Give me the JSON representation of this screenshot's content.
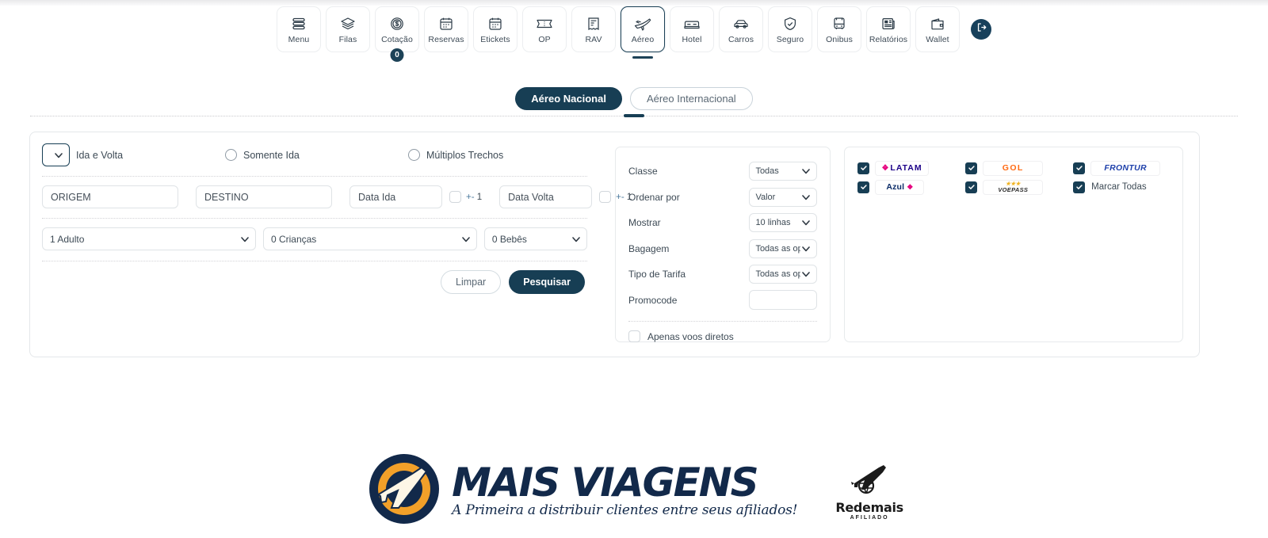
{
  "toolbar": {
    "items": [
      {
        "label": "Menu",
        "icon": "menu-stack-icon",
        "active": false
      },
      {
        "label": "Filas",
        "icon": "layers-icon",
        "active": false
      },
      {
        "label": "Cotação",
        "icon": "coin-dollar-icon",
        "active": false,
        "badge": "0"
      },
      {
        "label": "Reservas",
        "icon": "calendar-icon",
        "active": false
      },
      {
        "label": "Etickets",
        "icon": "calendar-icon",
        "active": false
      },
      {
        "label": "OP",
        "icon": "ticket-icon",
        "active": false
      },
      {
        "label": "RAV",
        "icon": "receipt-icon",
        "active": false
      },
      {
        "label": "Aéreo",
        "icon": "airplane-icon",
        "active": true
      },
      {
        "label": "Hotel",
        "icon": "bed-icon",
        "active": false
      },
      {
        "label": "Carros",
        "icon": "car-icon",
        "active": false
      },
      {
        "label": "Seguro",
        "icon": "shield-icon",
        "active": false
      },
      {
        "label": "Onibus",
        "icon": "bus-icon",
        "active": false
      },
      {
        "label": "Relatórios",
        "icon": "report-icon",
        "active": false
      },
      {
        "label": "Wallet",
        "icon": "wallet-icon",
        "active": false
      }
    ],
    "logout_icon": "logout-icon"
  },
  "tabs": [
    {
      "label": "Aéreo Nacional",
      "selected": true
    },
    {
      "label": "Aéreo Internacional",
      "selected": false
    }
  ],
  "search": {
    "trip_types": [
      {
        "label": "Ida e Volta",
        "selected": true
      },
      {
        "label": "Somente Ida",
        "selected": false
      },
      {
        "label": "Múltiplos Trechos",
        "selected": false
      }
    ],
    "origem": {
      "value": "",
      "placeholder": "ORIGEM"
    },
    "destino": {
      "value": "",
      "placeholder": "DESTINO"
    },
    "data_ida": {
      "value": "",
      "placeholder": "Data Ida"
    },
    "data_volta": {
      "value": "",
      "placeholder": "Data Volta"
    },
    "flex_ida": {
      "label": "+- 1",
      "checked": false
    },
    "flex_volta": {
      "label": "+- 1",
      "checked": false
    },
    "adultos": {
      "value": "1 Adulto"
    },
    "criancas": {
      "value": "0 Crianças"
    },
    "bebes": {
      "value": "0 Bebês"
    },
    "clear_label": "Limpar",
    "search_label": "Pesquisar"
  },
  "filters": {
    "rows": [
      {
        "label": "Classe",
        "value": "Todas",
        "type": "select"
      },
      {
        "label": "Ordenar por",
        "value": "Valor",
        "type": "select"
      },
      {
        "label": "Mostrar",
        "value": "10 linhas",
        "type": "select"
      },
      {
        "label": "Bagagem",
        "value": "Todas as op",
        "type": "select"
      },
      {
        "label": "Tipo de Tarifa",
        "value": "Todas as op",
        "type": "select"
      },
      {
        "label": "Promocode",
        "value": "",
        "type": "text"
      }
    ],
    "direct_only": {
      "label": "Apenas voos diretos",
      "checked": false
    }
  },
  "airlines": {
    "items": [
      {
        "name": "LATAM",
        "kind": "logo-latam",
        "checked": true
      },
      {
        "name": "GOL",
        "kind": "logo-gol",
        "checked": true
      },
      {
        "name": "FRONTUR",
        "kind": "logo-frontur",
        "checked": true
      },
      {
        "name": "Azul",
        "kind": "logo-azul",
        "checked": true
      },
      {
        "name": "VOEPASS",
        "kind": "logo-voepass",
        "checked": true
      },
      {
        "name": "Marcar Todas",
        "kind": "text",
        "checked": true
      }
    ]
  },
  "footer": {
    "brand_title": "MAIS VIAGENS",
    "brand_tagline": "A Primeira a distribuir clientes entre seus afiliados!",
    "partner_name": "Redemais",
    "partner_sub": "AFILIADO"
  },
  "colors": {
    "accent_dark": "#173e54",
    "brand_navy": "#12294a",
    "brand_orange": "#f2a029"
  }
}
